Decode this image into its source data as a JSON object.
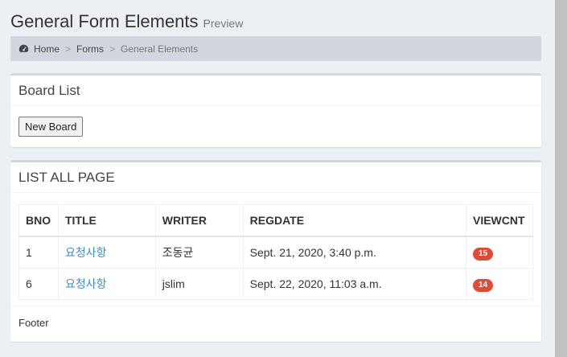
{
  "header": {
    "title": "General Form Elements",
    "subtitle": "Preview"
  },
  "breadcrumb": {
    "icon": "dashboard-icon",
    "items": [
      "Home",
      "Forms",
      "General Elements"
    ],
    "separator": ">"
  },
  "board_list_box": {
    "title": "Board List",
    "new_button": "New Board"
  },
  "list_box": {
    "title": "LIST ALL PAGE",
    "columns": [
      "BNO",
      "TITLE",
      "WRITER",
      "REGDATE",
      "VIEWCNT"
    ],
    "rows": [
      {
        "bno": "1",
        "title": "요청사항",
        "writer": "조동균",
        "regdate": "Sept. 21, 2020, 3:40 p.m.",
        "viewcnt": "15"
      },
      {
        "bno": "6",
        "title": "요청사항",
        "writer": "jslim",
        "regdate": "Sept. 22, 2020, 11:03 a.m.",
        "viewcnt": "14"
      }
    ],
    "footer": "Footer"
  },
  "colors": {
    "background": "#ecf0f5",
    "link": "#3c8dbc",
    "badge": "#dd4b39",
    "breadcrumb_bg": "#d2d6de"
  }
}
